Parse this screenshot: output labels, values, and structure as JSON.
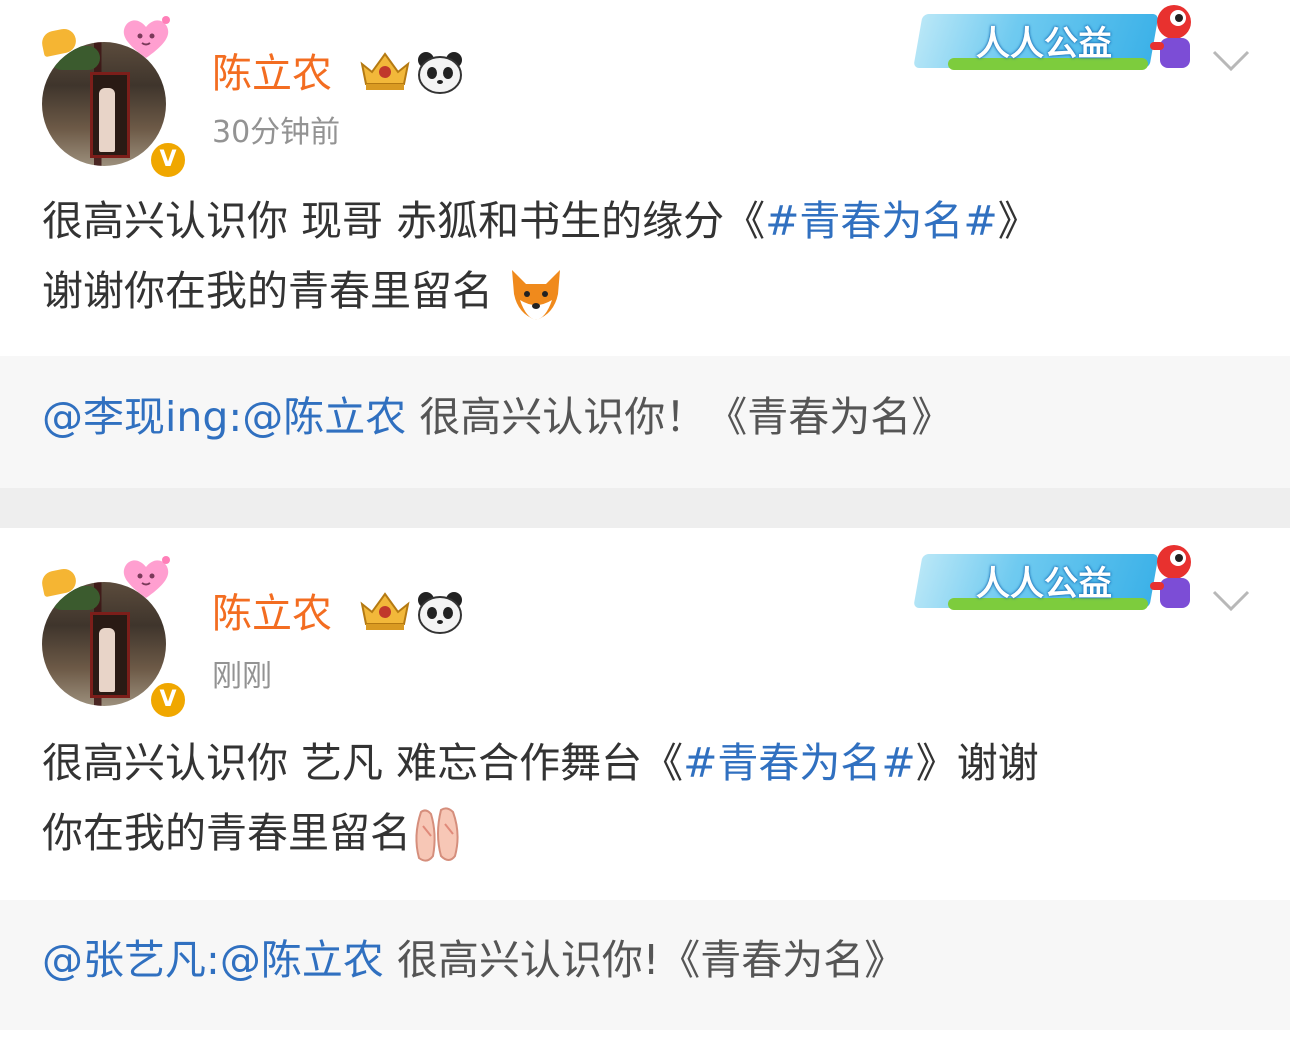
{
  "posts": [
    {
      "username": "陈立农",
      "timestamp": "30分钟前",
      "body_prefix": "很高兴认识你 现哥 赤狐和书生的缘分《",
      "topic": "#青春为名#",
      "body_suffix_line1": "》",
      "body_line2": "谢谢你在我的青春里留名",
      "emoji": "fox-emoji",
      "badge_label": "人人公益",
      "repost_mention": "@李现ing:@陈立农",
      "repost_text": " 很高兴认识你！《青春为名》"
    },
    {
      "username": "陈立农",
      "timestamp": "刚刚",
      "body_prefix": "很高兴认识你 艺凡 难忘合作舞台《",
      "topic": "#青春为名#",
      "body_suffix_line1": "》谢谢",
      "body_line2": "你在我的青春里留名",
      "emoji": "ballet-shoes-emoji",
      "badge_label": "人人公益",
      "repost_mention": "@张艺凡:@陈立农",
      "repost_text": " 很高兴认识你!《青春为名》"
    }
  ],
  "colors": {
    "username": "#f36d21",
    "topic": "#3070c0",
    "timestamp": "#939393",
    "repost_bg": "#f7f7f7",
    "divider_bg": "#eeeeee"
  }
}
